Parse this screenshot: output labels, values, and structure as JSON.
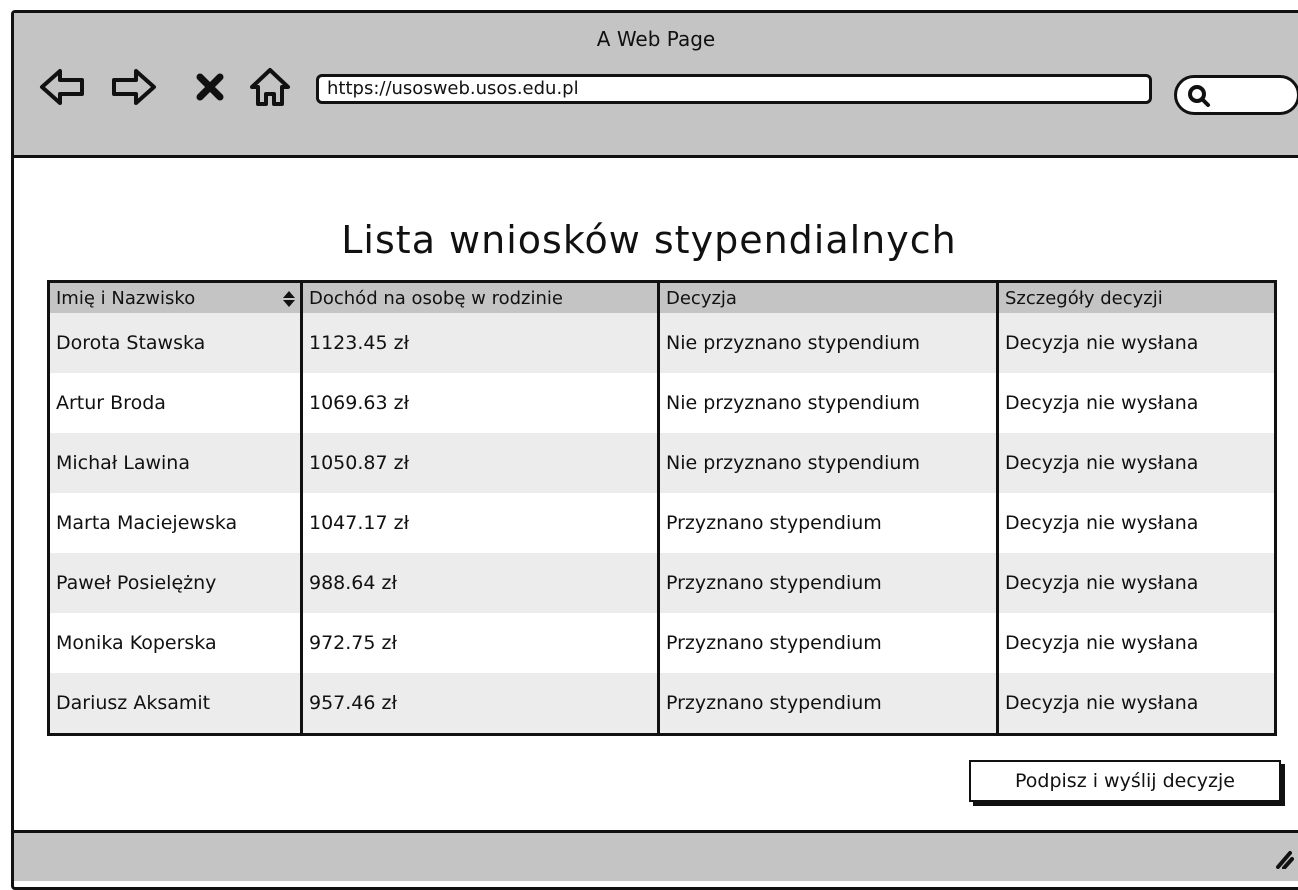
{
  "window": {
    "title": "A Web Page",
    "url": "https://usosweb.usos.edu.pl"
  },
  "nav": {
    "icons": [
      "back-arrow-icon",
      "forward-arrow-icon",
      "stop-icon",
      "home-icon"
    ],
    "search_icon": "search-icon"
  },
  "page": {
    "heading": "Lista wniosków stypendialnych"
  },
  "table": {
    "columns": [
      "Imię i Nazwisko",
      "Dochód na osobę w rodzinie",
      "Decyzja",
      "Szczegóły decyzji"
    ],
    "rows": [
      {
        "name": "Dorota Stawska",
        "income": "1123.45 zł",
        "decision": "Nie przyznano stypendium",
        "details": "Decyzja nie wysłana"
      },
      {
        "name": "Artur Broda",
        "income": "1069.63 zł",
        "decision": "Nie przyznano stypendium",
        "details": "Decyzja nie wysłana"
      },
      {
        "name": "Michał Lawina",
        "income": "1050.87 zł",
        "decision": "Nie przyznano stypendium",
        "details": "Decyzja nie wysłana"
      },
      {
        "name": "Marta Maciejewska",
        "income": "1047.17 zł",
        "decision": "Przyznano stypendium",
        "details": "Decyzja nie wysłana"
      },
      {
        "name": "Paweł Posielężny",
        "income": "988.64 zł",
        "decision": "Przyznano stypendium",
        "details": "Decyzja nie wysłana"
      },
      {
        "name": "Monika Koperska",
        "income": "972.75 zł",
        "decision": "Przyznano stypendium",
        "details": "Decyzja nie wysłana"
      },
      {
        "name": "Dariusz Aksamit",
        "income": "957.46 zł",
        "decision": "Przyznano stypendium",
        "details": "Decyzja nie wysłana"
      }
    ]
  },
  "actions": {
    "submit_label": "Podpisz i wyślij decyzje"
  },
  "colors": {
    "chrome": "#c4c4c4",
    "row_alt": "#ececec",
    "stroke": "#111111"
  }
}
